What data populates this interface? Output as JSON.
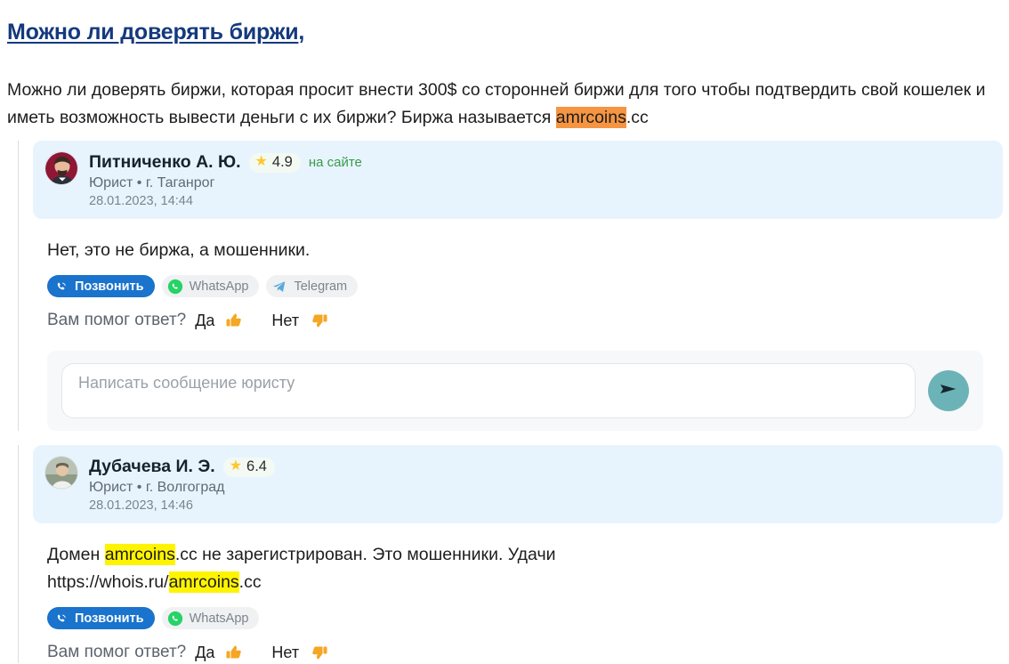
{
  "question": {
    "title_link": "Можно ли доверять биржи",
    "title_tail": ",",
    "body_part1": "Можно ли доверять биржи, которая просит внести 300$ со сторонней биржи для того чтобы подтвердить свой кошелек и иметь возможность вывести деньги с их биржи? Биржа называется ",
    "body_highlight": "amrcoins",
    "body_part2": ".cc",
    "highlight_color": "#f59542"
  },
  "labels": {
    "helpful_question": "Вам помог ответ?",
    "yes": "Да",
    "no": "Нет",
    "online_badge": "на сайте",
    "star_icon": "star-icon",
    "thumbs_up_icon": "thumbs-up-icon",
    "thumbs_down_icon": "thumbs-down-icon",
    "send_icon": "send-icon"
  },
  "composer": {
    "placeholder": "Написать сообщение юристу",
    "value": "",
    "send_label": "send-icon"
  },
  "answers": [
    {
      "author": "Питниченко А. Ю.",
      "rating": "4.9",
      "online": "на сайте",
      "meta": "Юрист • г. Таганрог",
      "date": "28.01.2023, 14:44",
      "text": "Нет, это не биржа, а мошенники.",
      "pills": [
        {
          "label": "Позвонить",
          "kind": "call"
        },
        {
          "label": "WhatsApp",
          "kind": "wa"
        },
        {
          "label": "Telegram",
          "kind": "tg"
        }
      ],
      "has_composer": true
    },
    {
      "author": "Дубачева И. Э.",
      "rating": "6.4",
      "online": "",
      "meta": "Юрист • г. Волгоград",
      "date": "28.01.2023, 14:46",
      "text_line1_pre": "Домен ",
      "text_line1_mark": "amrcoins",
      "text_line1_post": ".cc не зарегистрирован. Это мошенники. Удачи",
      "text_line2_pre": "https://whois.ru/",
      "text_line2_mark": "amrcoins",
      "text_line2_post": ".cc",
      "pills": [
        {
          "label": "Позвонить",
          "kind": "call"
        },
        {
          "label": "WhatsApp",
          "kind": "wa"
        }
      ],
      "has_composer": false
    }
  ],
  "colors": {
    "title": "#14397d",
    "answer_head_bg": "#e8f4fd",
    "call_pill": "#1a73cc",
    "whatsapp_green": "#25d366",
    "telegram_blue": "#5aa8e0",
    "thumb_orange": "#f5a623",
    "send_teal": "#6cb3b8",
    "online_green": "#3a9a4a",
    "highlight_yellow": "#fff400",
    "highlight_orange": "#f59542"
  }
}
